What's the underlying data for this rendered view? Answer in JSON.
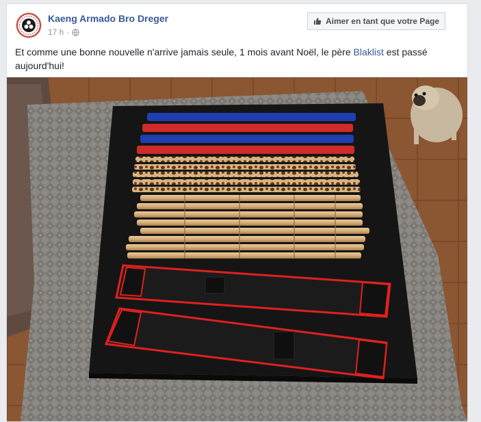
{
  "post": {
    "author": "Kaeng Armado Bro Dreger",
    "time": "17 h",
    "separator": "·",
    "like_page_label": "Aimer en tant que votre Page",
    "text_before": "Et comme une bonne nouvelle n'arrive jamais seule, 1 mois avant Noël, le père ",
    "mention": "Blaklist",
    "text_after": " est passé aujourd'hui!"
  },
  "colors": {
    "link": "#385898",
    "meta": "#90949c"
  },
  "icons": {
    "privacy": "globe-icon",
    "like": "thumbs-up-icon"
  }
}
